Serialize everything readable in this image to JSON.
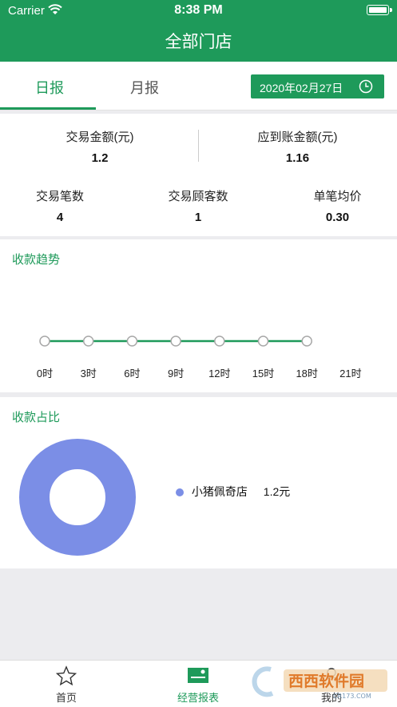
{
  "status_bar": {
    "carrier": "Carrier",
    "time": "8:38 PM"
  },
  "nav": {
    "title": "全部门店"
  },
  "tabs": {
    "day": "日报",
    "month": "月报",
    "active": "日报"
  },
  "date": {
    "label": "2020年02月27日",
    "icon": "clock-icon"
  },
  "summary": {
    "amount_label": "交易金额(元)",
    "amount_value": "1.2",
    "settle_label": "应到账金额(元)",
    "settle_value": "1.16",
    "count_label": "交易笔数",
    "count_value": "4",
    "customers_label": "交易顾客数",
    "customers_value": "1",
    "avg_label": "单笔均价",
    "avg_value": "0.30"
  },
  "trend": {
    "title": "收款趋势",
    "hours": [
      "0时",
      "3时",
      "6时",
      "9时",
      "12时",
      "15时",
      "18时",
      "21时"
    ],
    "points": 7
  },
  "ratio": {
    "title": "收款占比",
    "slices": [
      {
        "name": "小猪佩奇店",
        "amount": "1.2元",
        "value": 1.2,
        "color": "#7b8ee6"
      }
    ]
  },
  "tabbar": {
    "home": "首页",
    "report": "经营报表",
    "mine": "我的"
  },
  "colors": {
    "accent": "#1e9a5a",
    "pie": "#7b8ee6"
  },
  "watermark": {
    "text": "西西软件园",
    "sub": "CR173.COM"
  }
}
